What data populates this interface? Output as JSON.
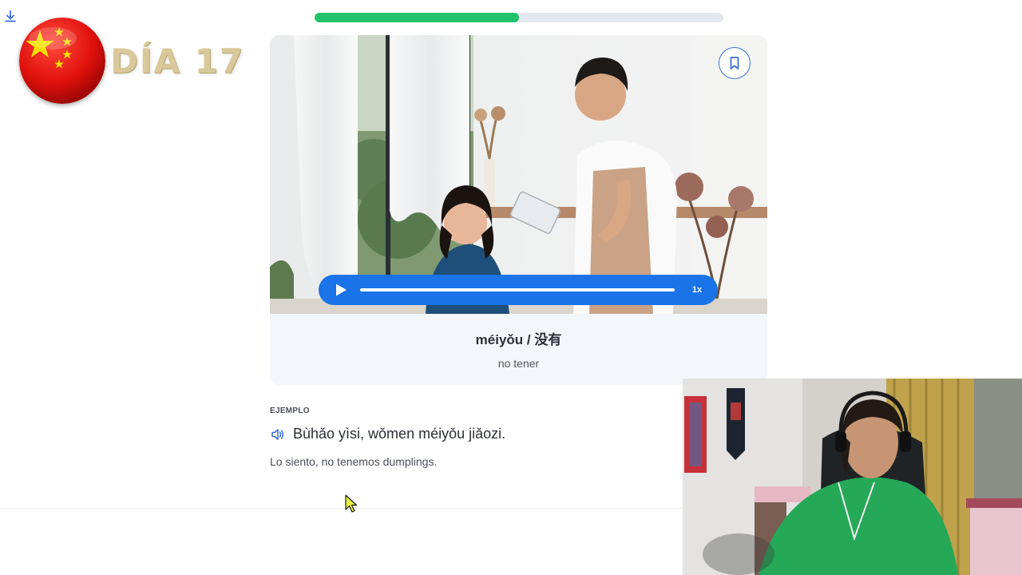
{
  "overlay": {
    "day_label": "DÍA 17"
  },
  "progress": {
    "fraction": 0.5,
    "fill_color": "#20c36b",
    "track_color": "#e3e7ee"
  },
  "lesson": {
    "word": "méiyǒu / 没有",
    "translation": "no tener",
    "audio": {
      "speed": "1x",
      "accent_color": "#1a73e8"
    }
  },
  "example": {
    "label": "EJEMPLO",
    "sentence": "Bùhǎo yìsi, wǒmen méiyǒu jiǎozi.",
    "translation": "Lo siento, no tenemos dumplings."
  },
  "icons": {
    "download": "download-icon",
    "bookmark": "bookmark-icon",
    "play": "play-icon",
    "speaker": "speaker-icon",
    "flag": "china-flag-icon",
    "cursor": "mouse-cursor-icon"
  }
}
